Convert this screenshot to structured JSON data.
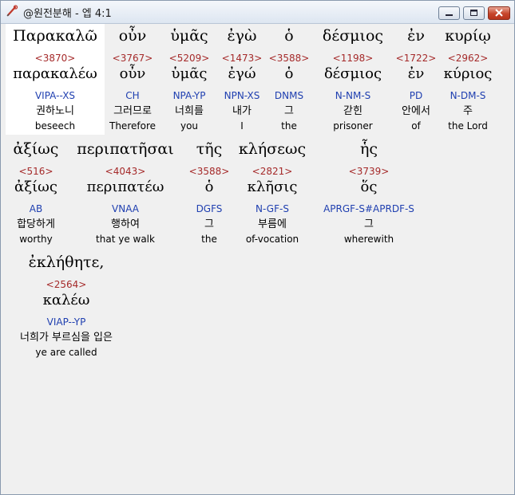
{
  "window": {
    "title": "@원전분해 - 엡 4:1"
  },
  "words": [
    {
      "greek": "Παρακαλῶ",
      "strong": "<3870>",
      "lemma": "παρακαλέω",
      "morph": "VIPA--XS",
      "korean": "권하노니",
      "english": "beseech"
    },
    {
      "greek": "οὖν",
      "strong": "<3767>",
      "lemma": "οὖν",
      "morph": "CH",
      "korean": "그러므로",
      "english": "Therefore"
    },
    {
      "greek": "ὑμᾶς",
      "strong": "<5209>",
      "lemma": "ὑμᾶς",
      "morph": "NPA-YP",
      "korean": "너희를",
      "english": "you"
    },
    {
      "greek": "ἐγὼ",
      "strong": "<1473>",
      "lemma": "ἐγώ",
      "morph": "NPN-XS",
      "korean": "내가",
      "english": "I"
    },
    {
      "greek": "ὁ",
      "strong": "<3588>",
      "lemma": "ὁ",
      "morph": "DNMS",
      "korean": "그",
      "english": "the"
    },
    {
      "greek": "δέσμιος",
      "strong": "<1198>",
      "lemma": "δέσμιος",
      "morph": "N-NM-S",
      "korean": "갇힌",
      "english": "prisoner"
    },
    {
      "greek": "ἐν",
      "strong": "<1722>",
      "lemma": "ἐν",
      "morph": "PD",
      "korean": "안에서",
      "english": "of"
    },
    {
      "greek": "κυρίῳ",
      "strong": "<2962>",
      "lemma": "κύριος",
      "morph": "N-DM-S",
      "korean": "주",
      "english": "the Lord"
    },
    {
      "greek": "ἀξίως",
      "strong": "<516>",
      "lemma": "ἀξίως",
      "morph": "AB",
      "korean": "합당하게",
      "english": "worthy"
    },
    {
      "greek": "περιπατῆσαι",
      "strong": "<4043>",
      "lemma": "περιπατέω",
      "morph": "VNAA",
      "korean": "행하여",
      "english": "that ye walk"
    },
    {
      "greek": "τῆς",
      "strong": "<3588>",
      "lemma": "ὁ",
      "morph": "DGFS",
      "korean": "그",
      "english": "the"
    },
    {
      "greek": "κλήσεως",
      "strong": "<2821>",
      "lemma": "κλῆσις",
      "morph": "N-GF-S",
      "korean": "부름에",
      "english": "of-vocation"
    },
    {
      "greek": "ἧς",
      "strong": "<3739>",
      "lemma": "ὅς",
      "morph": "APRGF-S#APRDF-S",
      "korean": "그",
      "english": "wherewith"
    },
    {
      "greek": "ἐκλήθητε,",
      "strong": "<2564>",
      "lemma": "καλέω",
      "morph": "VIAP--YP",
      "korean": "너희가 부르심을 입은",
      "english": "ye are called"
    }
  ]
}
